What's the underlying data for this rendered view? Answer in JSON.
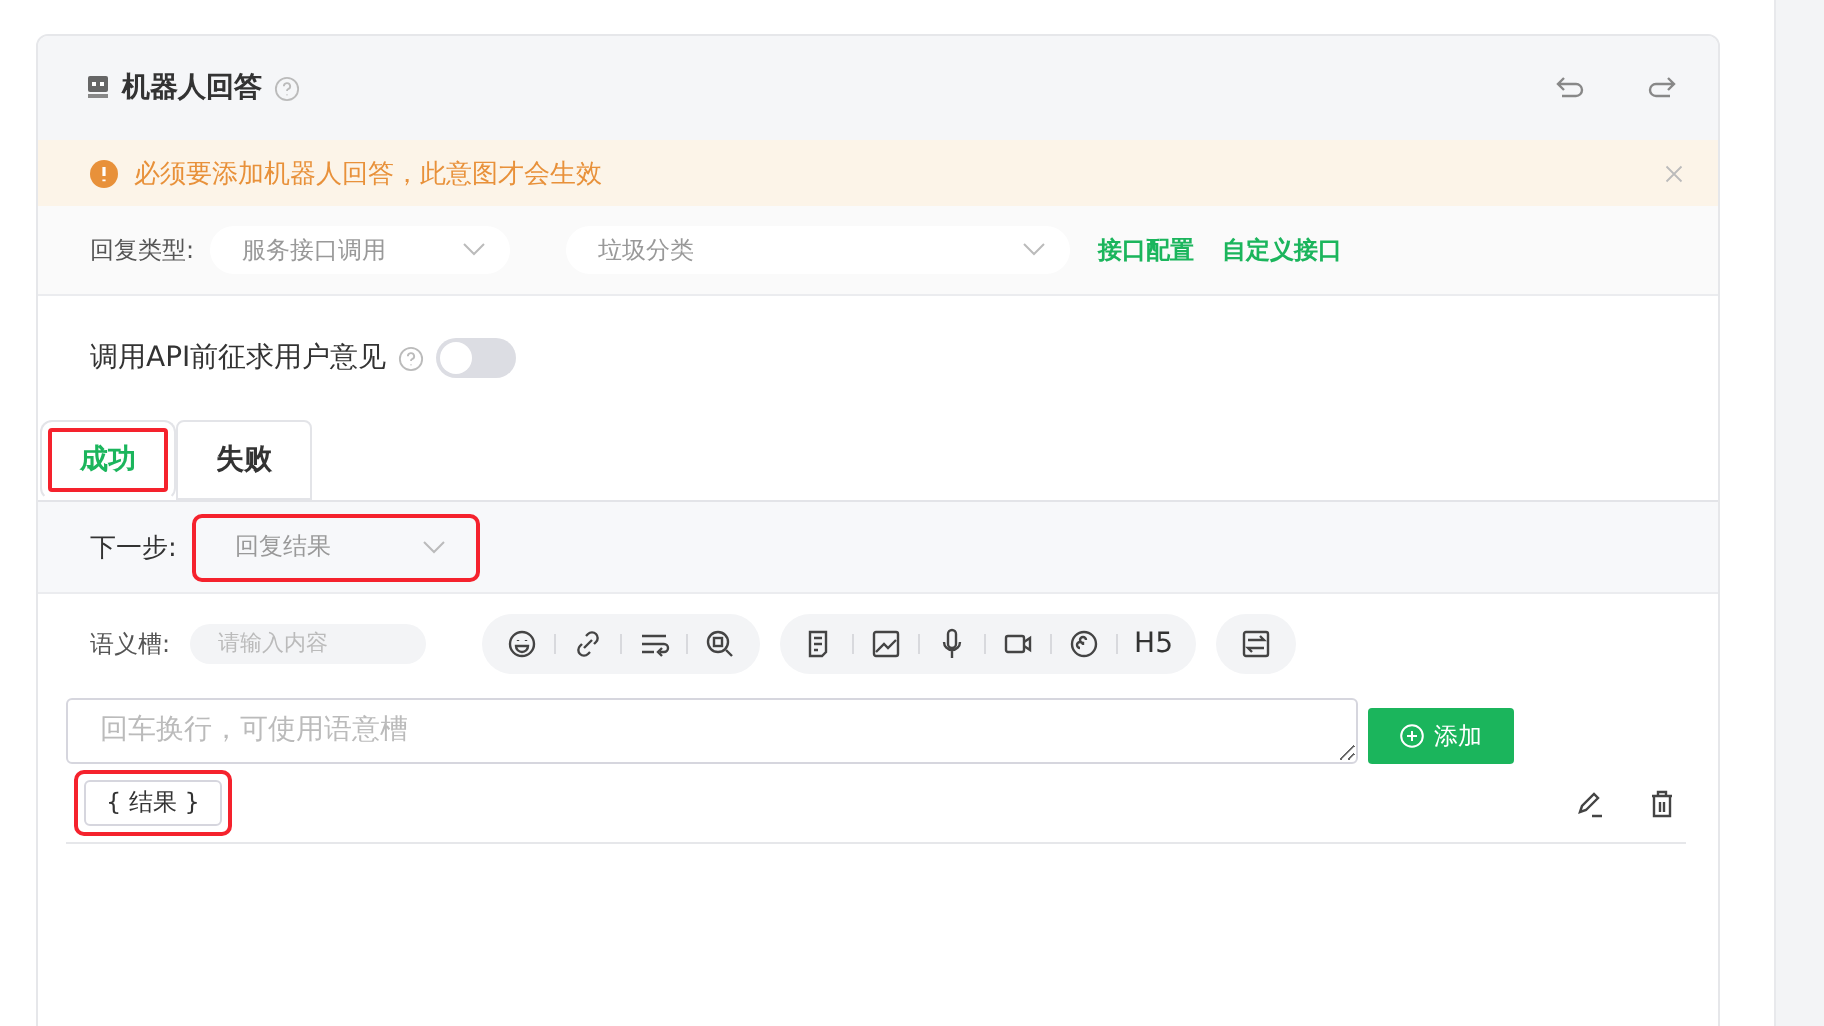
{
  "card": {
    "title": "机器人回答"
  },
  "alert": {
    "message": "必须要添加机器人回答，此意图才会生效"
  },
  "reply_type": {
    "label": "回复类型:",
    "select_1": {
      "value": "服务接口调用"
    },
    "select_2": {
      "value": "垃圾分类"
    },
    "links": [
      "接口配置",
      "自定义接口"
    ]
  },
  "consent": {
    "label": "调用API前征求用户意见",
    "on": false
  },
  "tabs": [
    {
      "label": "成功",
      "selected": true,
      "highlighted": true
    },
    {
      "label": "失败",
      "selected": false,
      "highlighted": false
    }
  ],
  "next_step": {
    "label": "下一步:",
    "value": "回复结果",
    "highlighted": true
  },
  "slot": {
    "label": "语义槽:",
    "placeholder": "请输入内容"
  },
  "toolbar": {
    "text_tool": "H5"
  },
  "editor": {
    "placeholder": "回车换行，可使用语意槽",
    "add_button": "添加"
  },
  "answers": [
    {
      "text": "{ 结果 }",
      "highlighted": true
    }
  ]
}
